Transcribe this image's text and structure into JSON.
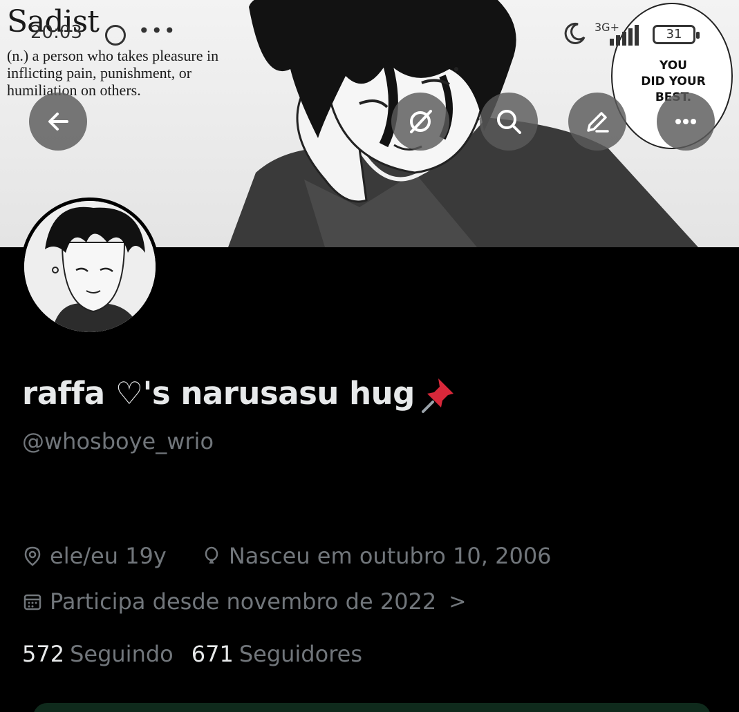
{
  "banner": {
    "definition_title": "Sadist",
    "definition_body": "(n.) a person who takes pleasure in inflicting pain, punishment, or humiliation on others.",
    "bubble_lines": [
      "YOU",
      "DID YOUR",
      "BEST."
    ]
  },
  "status_bar": {
    "time": "20:03",
    "network": "3G+",
    "battery": "31"
  },
  "actions": {
    "back_icon": "arrow-left-icon",
    "grok_icon": "grok-icon",
    "search_icon": "search-icon",
    "edit_icon": "pencil-icon",
    "more_icon": "more-icon"
  },
  "profile": {
    "display_name": "raffa ♡'s narusasu hug",
    "handle": "@whosboye_wrio",
    "location": "ele/eu 19y",
    "birthday": "Nasceu em outubro 10, 2006",
    "joined": "Participa desde novembro de 2022",
    "following_count": "572",
    "following_label": "Seguindo",
    "followers_count": "671",
    "followers_label": "Seguidores"
  },
  "colors": {
    "background": "#000000",
    "text_primary": "#e7e9ea",
    "text_secondary": "#71767b"
  }
}
